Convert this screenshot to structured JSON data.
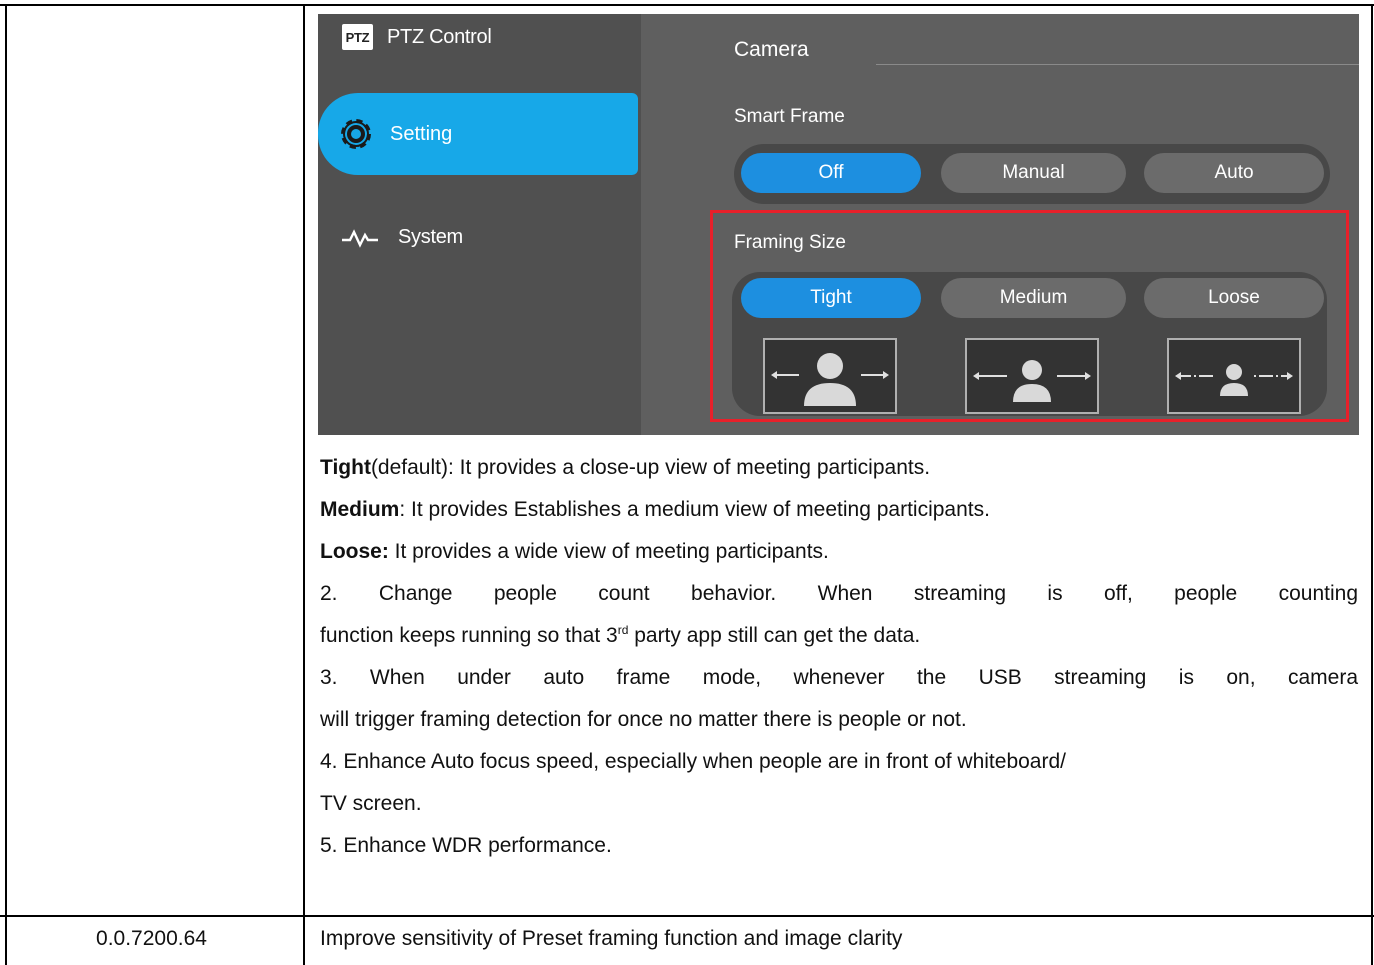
{
  "ui": {
    "nav": {
      "ptz_badge": "PTZ",
      "ptz_label": "PTZ Control",
      "setting_label": "Setting",
      "system_label": "System"
    },
    "camera_title": "Camera",
    "smart_frame": {
      "label": "Smart Frame",
      "options": [
        "Off",
        "Manual",
        "Auto"
      ],
      "selected": "Off"
    },
    "framing_size": {
      "label": "Framing Size",
      "options": [
        "Tight",
        "Medium",
        "Loose"
      ],
      "selected": "Tight"
    }
  },
  "doc": {
    "tight_term": "Tight",
    "tight_desc": "(default): It provides a close-up view of meeting participants.",
    "medium_term": "Medium",
    "medium_desc": ": It provides Establishes a medium view of meeting participants.",
    "loose_term": "Loose:",
    "loose_desc": " It provides a wide view of meeting participants.",
    "item2_line1": "2. Change people count behavior. When streaming is off, people counting",
    "item2_line2_pre": "function keeps running so that 3",
    "item2_line2_sup": "rd",
    "item2_line2_post": " party app still can get the data.",
    "item3_line1": "3. When under auto frame mode, whenever the USB streaming is on, camera",
    "item3_line2": "will trigger framing detection for once no matter there is people or not.",
    "item4_line1": "4. Enhance Auto focus speed, especially when people are in front of whiteboard/",
    "item4_line2": "TV screen.",
    "item5": "5. Enhance WDR performance.",
    "version": "0.0.7200.64",
    "version_desc": "Improve sensitivity of Preset framing function and image clarity"
  },
  "colors": {
    "accent": "#17a8e8",
    "active_button": "#1d8fe0",
    "highlight_box": "#e8202a"
  }
}
